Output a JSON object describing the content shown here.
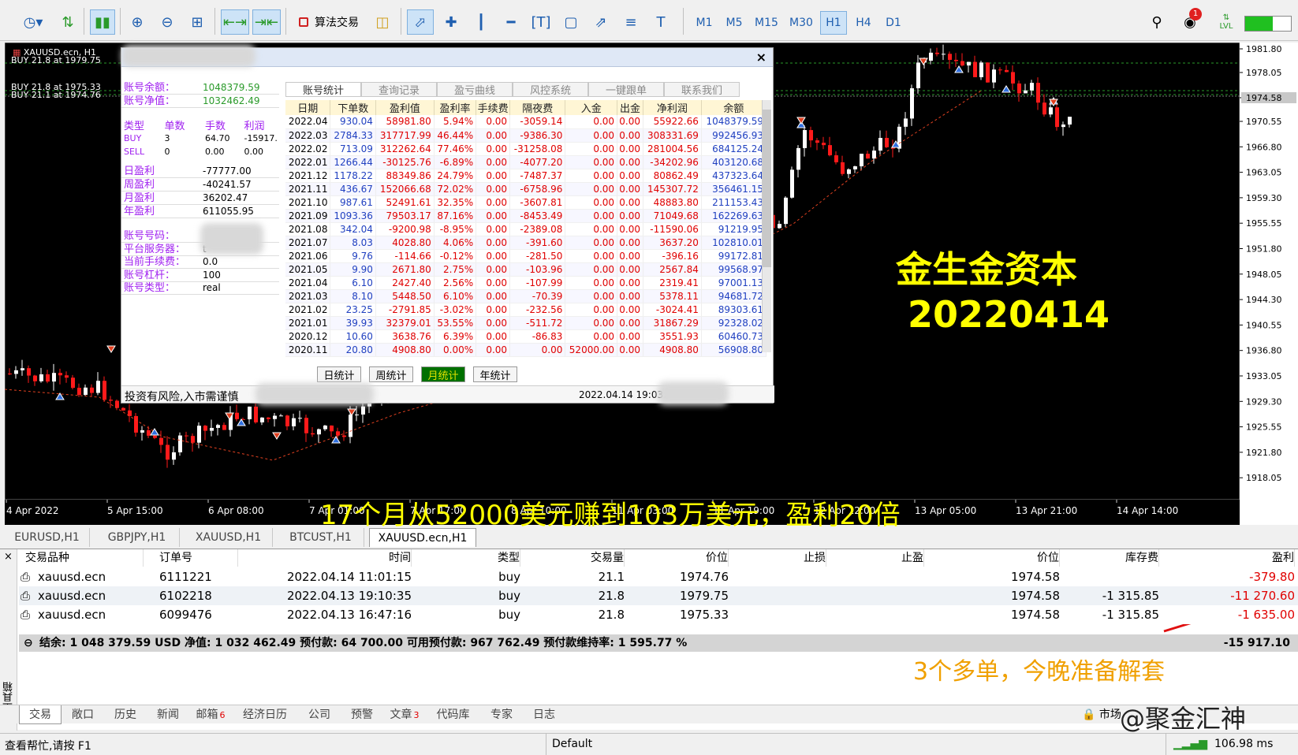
{
  "toolbar": {
    "algo_trading_label": "算法交易",
    "timeframes": [
      "M1",
      "M5",
      "M15",
      "M30",
      "H1",
      "H4",
      "D1"
    ],
    "active_timeframe": "H1",
    "notification_count": "1",
    "lvl_label": "LVL"
  },
  "chart": {
    "symbol_label": "XAUUSD.ecn, H1",
    "buy_line_1": "BUY 21.8 at 1979.75",
    "buy_line_2": "BUY 21.8 at 1975.33",
    "buy_line_3": "BUY 21.1 at 1974.76",
    "current_price": "1974.58",
    "price_labels": [
      "1981.80",
      "1978.05",
      "1974.58",
      "1970.55",
      "1966.80",
      "1963.05",
      "1959.30",
      "1955.55",
      "1951.80",
      "1948.05",
      "1944.30",
      "1940.55",
      "1936.80",
      "1933.05",
      "1929.30",
      "1925.55",
      "1921.80",
      "1918.05"
    ],
    "time_labels": [
      "4 Apr 2022",
      "5 Apr 15:00",
      "6 Apr 08:00",
      "7 Apr 01:00",
      "7 Apr 17:00",
      "8 Apr 10:00",
      "11 Apr 03:00",
      "11 Apr 19:00",
      "12 Apr 12:00",
      "13 Apr 05:00",
      "13 Apr 21:00",
      "14 Apr 14:00"
    ],
    "overlay_brand": "金生金资本",
    "overlay_date": "20220414",
    "overlay_profit": "17个月从52000美元赚到103万美元，盈利20倍",
    "colors": {
      "bull": "#ffffff",
      "bear": "#ff0000",
      "text": "#ffff00"
    }
  },
  "panel": {
    "close_label": "×",
    "account": [
      {
        "k": "账号余额：",
        "v": "1048379.59"
      },
      {
        "k": "账号净值：",
        "v": "1032462.49"
      }
    ],
    "pos_headers": [
      "类型",
      "单数",
      "手数",
      "利润"
    ],
    "positions": [
      [
        "BUY",
        "3",
        "64.70",
        "-15917."
      ],
      [
        "SELL",
        "0",
        "0.00",
        "0.00"
      ]
    ],
    "pnl": [
      {
        "k": "日盈利",
        "v": "-77777.00"
      },
      {
        "k": "周盈利",
        "v": "-40241.57"
      },
      {
        "k": "月盈利",
        "v": "36202.47"
      },
      {
        "k": "年盈利",
        "v": "611055.95"
      }
    ],
    "info": [
      {
        "k": "账号号码：",
        "v": ""
      },
      {
        "k": "平台服务器：",
        "v": "t"
      },
      {
        "k": "当前手续费：",
        "v": "0.0"
      },
      {
        "k": "账号杠杆：",
        "v": "100"
      },
      {
        "k": "账号类型：",
        "v": "real"
      }
    ],
    "tabs": [
      "账号统计",
      "查询记录",
      "盈亏曲线",
      "风控系统",
      "一键跟单",
      "联系我们"
    ],
    "stat_headers": [
      "日期",
      "下单数",
      "盈利值",
      "盈利率",
      "手续费",
      "隔夜费",
      "入金",
      "出金",
      "净利润",
      "余额"
    ],
    "stat_rows": [
      [
        "2022.04",
        "930.04",
        "58981.80",
        "5.94%",
        "0.00",
        "-3059.14",
        "0.00",
        "0.00",
        "55922.66",
        "1048379.59"
      ],
      [
        "2022.03",
        "2784.33",
        "317717.99",
        "46.44%",
        "0.00",
        "-9386.30",
        "0.00",
        "0.00",
        "308331.69",
        "992456.93"
      ],
      [
        "2022.02",
        "713.09",
        "312262.64",
        "77.46%",
        "0.00",
        "-31258.08",
        "0.00",
        "0.00",
        "281004.56",
        "684125.24"
      ],
      [
        "2022.01",
        "1266.44",
        "-30125.76",
        "-6.89%",
        "0.00",
        "-4077.20",
        "0.00",
        "0.00",
        "-34202.96",
        "403120.68"
      ],
      [
        "2021.12",
        "1178.22",
        "88349.86",
        "24.79%",
        "0.00",
        "-7487.37",
        "0.00",
        "0.00",
        "80862.49",
        "437323.64"
      ],
      [
        "2021.11",
        "436.67",
        "152066.68",
        "72.02%",
        "0.00",
        "-6758.96",
        "0.00",
        "0.00",
        "145307.72",
        "356461.15"
      ],
      [
        "2021.10",
        "987.61",
        "52491.61",
        "32.35%",
        "0.00",
        "-3607.81",
        "0.00",
        "0.00",
        "48883.80",
        "211153.43"
      ],
      [
        "2021.09",
        "1093.36",
        "79503.17",
        "87.16%",
        "0.00",
        "-8453.49",
        "0.00",
        "0.00",
        "71049.68",
        "162269.63"
      ],
      [
        "2021.08",
        "342.04",
        "-9200.98",
        "-8.95%",
        "0.00",
        "-2389.08",
        "0.00",
        "0.00",
        "-11590.06",
        "91219.95"
      ],
      [
        "2021.07",
        "8.03",
        "4028.80",
        "4.06%",
        "0.00",
        "-391.60",
        "0.00",
        "0.00",
        "3637.20",
        "102810.01"
      ],
      [
        "2021.06",
        "9.76",
        "-114.66",
        "-0.12%",
        "0.00",
        "-281.50",
        "0.00",
        "0.00",
        "-396.16",
        "99172.81"
      ],
      [
        "2021.05",
        "9.90",
        "2671.80",
        "2.75%",
        "0.00",
        "-103.96",
        "0.00",
        "0.00",
        "2567.84",
        "99568.97"
      ],
      [
        "2021.04",
        "6.10",
        "2427.40",
        "2.56%",
        "0.00",
        "-107.99",
        "0.00",
        "0.00",
        "2319.41",
        "97001.13"
      ],
      [
        "2021.03",
        "8.10",
        "5448.50",
        "6.10%",
        "0.00",
        "-70.39",
        "0.00",
        "0.00",
        "5378.11",
        "94681.72"
      ],
      [
        "2021.02",
        "23.25",
        "-2791.85",
        "-3.02%",
        "0.00",
        "-232.56",
        "0.00",
        "0.00",
        "-3024.41",
        "89303.61"
      ],
      [
        "2021.01",
        "39.93",
        "32379.01",
        "53.55%",
        "0.00",
        "-511.72",
        "0.00",
        "0.00",
        "31867.29",
        "92328.02"
      ],
      [
        "2020.12",
        "10.60",
        "3638.76",
        "6.39%",
        "0.00",
        "-86.83",
        "0.00",
        "0.00",
        "3551.93",
        "60460.73"
      ],
      [
        "2020.11",
        "20.80",
        "4908.80",
        "0.00%",
        "0.00",
        "0.00",
        "52000.00",
        "0.00",
        "4908.80",
        "56908.80"
      ]
    ],
    "period_buttons": [
      "日统计",
      "周统计",
      "月统计",
      "年统计"
    ],
    "risk_note": "投资有风险,入市需谨慎",
    "timestamp": "2022.04.14 19:03:0"
  },
  "chart_tabs": [
    "EURUSD,H1",
    "GBPJPY,H1",
    "XAUUSD,H1",
    "BTCUST,H1",
    "XAUUSD.ecn,H1"
  ],
  "terminal": {
    "headers": [
      "交易品种",
      "订单号",
      "时间",
      "类型",
      "交易量",
      "价位",
      "止损",
      "止盈",
      "价位",
      "库存费",
      "盈利"
    ],
    "rows": [
      [
        "xauusd.ecn",
        "6111221",
        "2022.04.14 11:01:15",
        "buy",
        "21.1",
        "1974.76",
        "",
        "",
        "1974.58",
        "",
        "-379.80"
      ],
      [
        "xauusd.ecn",
        "6102218",
        "2022.04.13 19:10:35",
        "buy",
        "21.8",
        "1979.75",
        "",
        "",
        "1974.58",
        "-1 315.85",
        "-11 270.60"
      ],
      [
        "xauusd.ecn",
        "6099476",
        "2022.04.13 16:47:16",
        "buy",
        "21.8",
        "1975.33",
        "",
        "",
        "1974.58",
        "-1 315.85",
        "-1 635.00"
      ]
    ],
    "summary": "结余: 1 048 379.59 USD  净值: 1 032 462.49  预付款: 64 700.00  可用预付款: 967 762.49  预付款维持率: 1 595.77 %",
    "summary_total": "-15 917.10",
    "note": "3个多单，今晚准备解套",
    "side_label": "工具箱"
  },
  "bottom_tabs": [
    {
      "label": "交易",
      "badge": ""
    },
    {
      "label": "敞口",
      "badge": ""
    },
    {
      "label": "历史",
      "badge": ""
    },
    {
      "label": "新闻",
      "badge": ""
    },
    {
      "label": "邮箱",
      "badge": "6"
    },
    {
      "label": "经济日历",
      "badge": ""
    },
    {
      "label": "公司",
      "badge": ""
    },
    {
      "label": "预警",
      "badge": ""
    },
    {
      "label": "文章",
      "badge": "3"
    },
    {
      "label": "代码库",
      "badge": ""
    },
    {
      "label": "专家",
      "badge": ""
    },
    {
      "label": "日志",
      "badge": ""
    }
  ],
  "bottom_right": {
    "market_label": "市场",
    "watermark": "@聚金汇神"
  },
  "status": {
    "help": "查看帮忙,请按 F1",
    "profile": "Default",
    "ping": "106.98 ms"
  }
}
